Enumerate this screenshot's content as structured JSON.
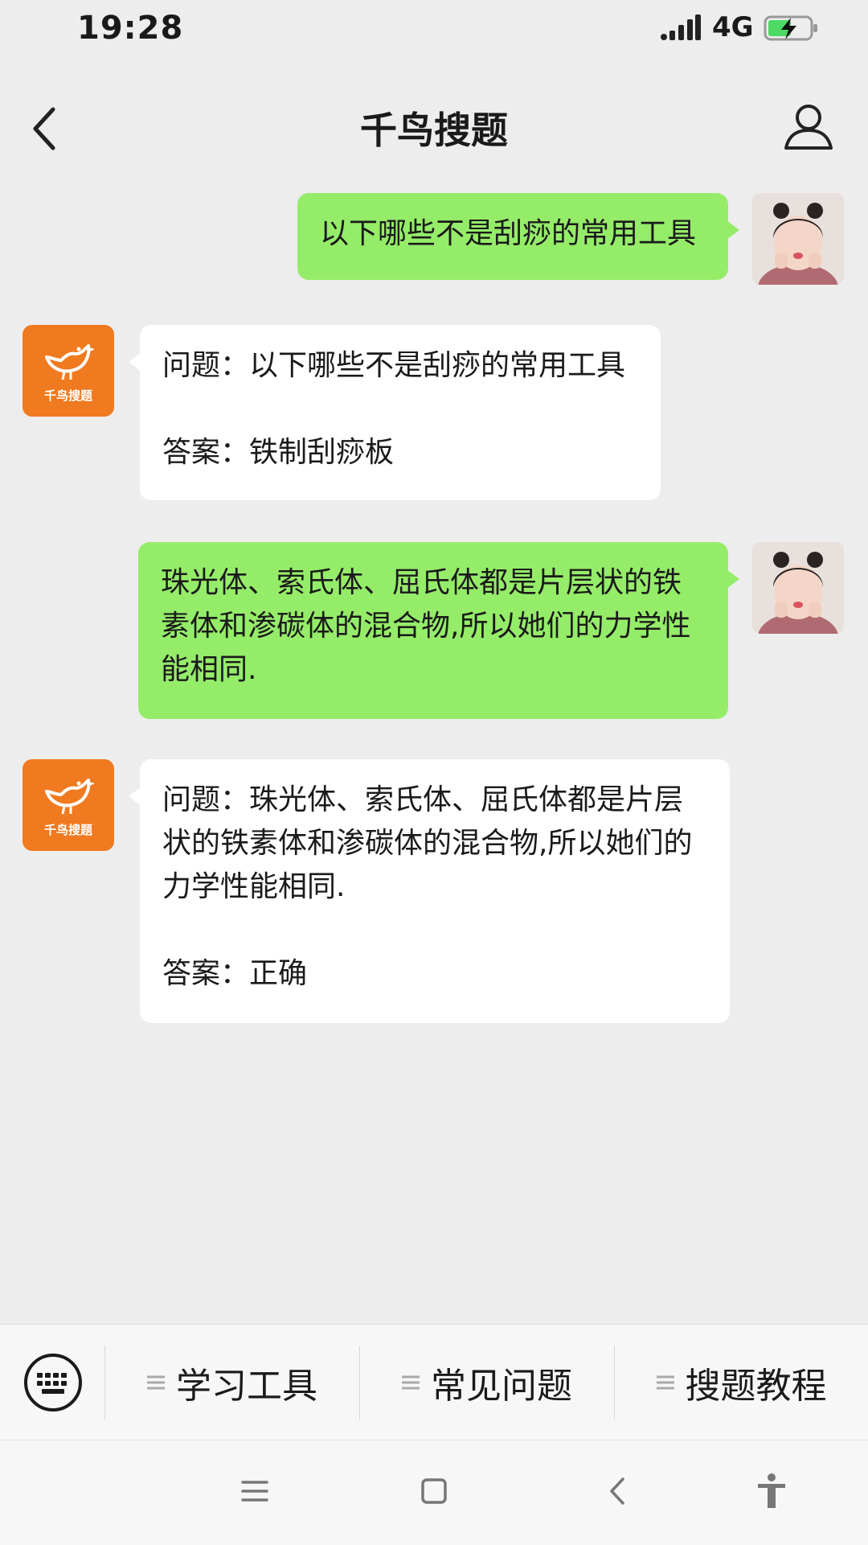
{
  "status_bar": {
    "time": "19:28",
    "network": "4G"
  },
  "header": {
    "title": "千鸟搜题"
  },
  "bot": {
    "avatar_label": "千鸟搜题"
  },
  "messages": [
    {
      "from": "user",
      "text": "以下哪些不是刮痧的常用工具"
    },
    {
      "from": "bot",
      "text": "问题：以下哪些不是刮痧的常用工具\n\n答案：铁制刮痧板"
    },
    {
      "from": "user",
      "text": "珠光体、索氏体、屈氏体都是片层状的铁素体和渗碳体的混合物,所以她们的力学性能相同."
    },
    {
      "from": "bot",
      "text": "问题：珠光体、索氏体、屈氏体都是片层状的铁素体和渗碳体的混合物,所以她们的力学性能相同.\n\n答案：正确"
    }
  ],
  "menu": {
    "items": [
      "学习工具",
      "常见问题",
      "搜题教程"
    ]
  },
  "colors": {
    "user_bubble": "#95ec69",
    "bot_bubble": "#ffffff",
    "bot_avatar": "#f07a1f",
    "background": "#ededed"
  },
  "icons": [
    "signal-icon",
    "battery-charging-icon",
    "back-arrow-icon",
    "profile-icon",
    "keyboard-icon",
    "menu-lines-icon",
    "nav-menu-icon",
    "nav-home-icon",
    "nav-back-icon",
    "accessibility-icon"
  ]
}
